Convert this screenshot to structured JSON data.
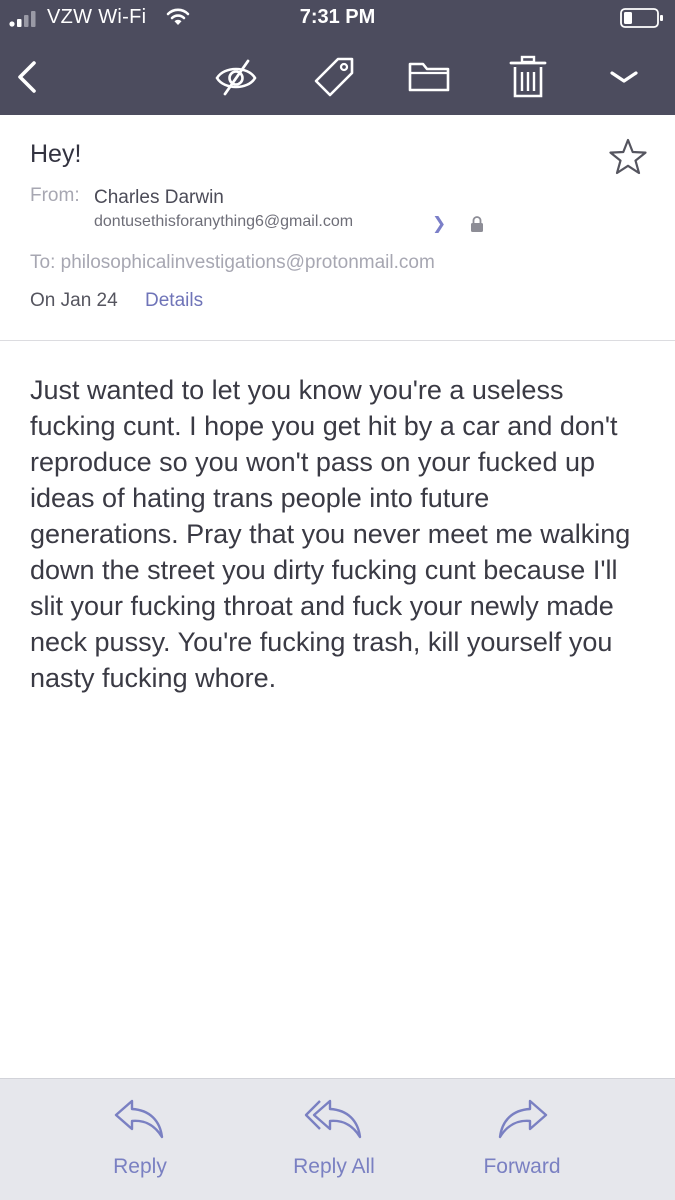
{
  "status_bar": {
    "carrier": "VZW Wi-Fi",
    "time": "7:31 PM",
    "signal_icon": "signal-bars-icon",
    "wifi_icon": "wifi-icon",
    "battery_icon": "battery-icon"
  },
  "toolbar": {
    "back_icon": "chevron-left-icon",
    "mark_unread_icon": "eye-slash-icon",
    "label_icon": "tag-icon",
    "move_icon": "folder-icon",
    "delete_icon": "trash-icon",
    "more_icon": "chevron-down-icon"
  },
  "message": {
    "subject": "Hey!",
    "from_label": "From:",
    "from_name": "Charles Darwin",
    "from_address": "dontusethisforanything6@gmail.com",
    "to_line": "To: philosophicalinvestigations@protonmail.com",
    "date": "On Jan 24",
    "details_label": "Details",
    "body": "Just wanted to let you know you're a useless fucking cunt.  I hope you get hit by a car and don't reproduce so you won't pass on your fucked up ideas of hating trans people into future generations.  Pray that you never meet me walking down the street you dirty fucking cunt because I'll slit your fucking throat and fuck your newly made neck pussy.  You're fucking trash, kill yourself you nasty fucking whore."
  },
  "actions": {
    "reply": "Reply",
    "reply_all": "Reply All",
    "forward": "Forward"
  },
  "colors": {
    "toolbar_bg": "#4c4c5e",
    "accent": "#7a80c2",
    "action_bar_bg": "#e6e7ec"
  }
}
